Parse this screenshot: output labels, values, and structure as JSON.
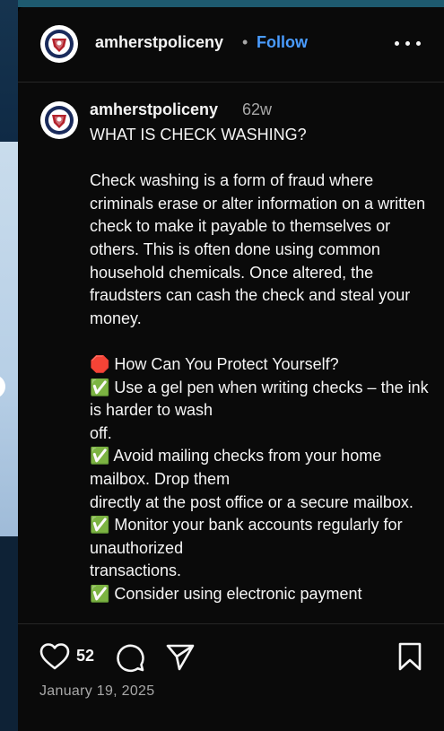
{
  "header": {
    "username": "amherstpoliceny",
    "separator": "•",
    "follow_label": "Follow",
    "more_icon": "more-horizontal-icon"
  },
  "caption": {
    "username": "amherstpoliceny",
    "time_ago": "62w",
    "text": "WHAT IS CHECK WASHING?\n\nCheck washing is a form of fraud where criminals erase or alter information on a written check to make it payable to themselves or others. This is often done using common household chemicals. Once altered, the fraudsters can cash the check and steal your money.\n\n🛑 How Can You Protect Yourself?\n✅ Use a gel pen when writing checks – the ink is harder to wash\n  off.\n✅ Avoid mailing checks from your home mailbox. Drop them\n  directly at the post office or a secure mailbox.\n✅ Monitor your bank accounts regularly for unauthorized\n  transactions.\n✅ Consider using electronic payment"
  },
  "actions": {
    "like_count": "52",
    "like_icon": "heart-icon",
    "comment_icon": "comment-icon",
    "share_icon": "send-icon",
    "save_icon": "bookmark-icon",
    "date": "January 19, 2025"
  },
  "colors": {
    "background": "#0a0a0a",
    "text": "#f5f5f5",
    "secondary_text": "#a8a8a8",
    "follow_accent": "#4a9cff",
    "divider": "#262626"
  }
}
